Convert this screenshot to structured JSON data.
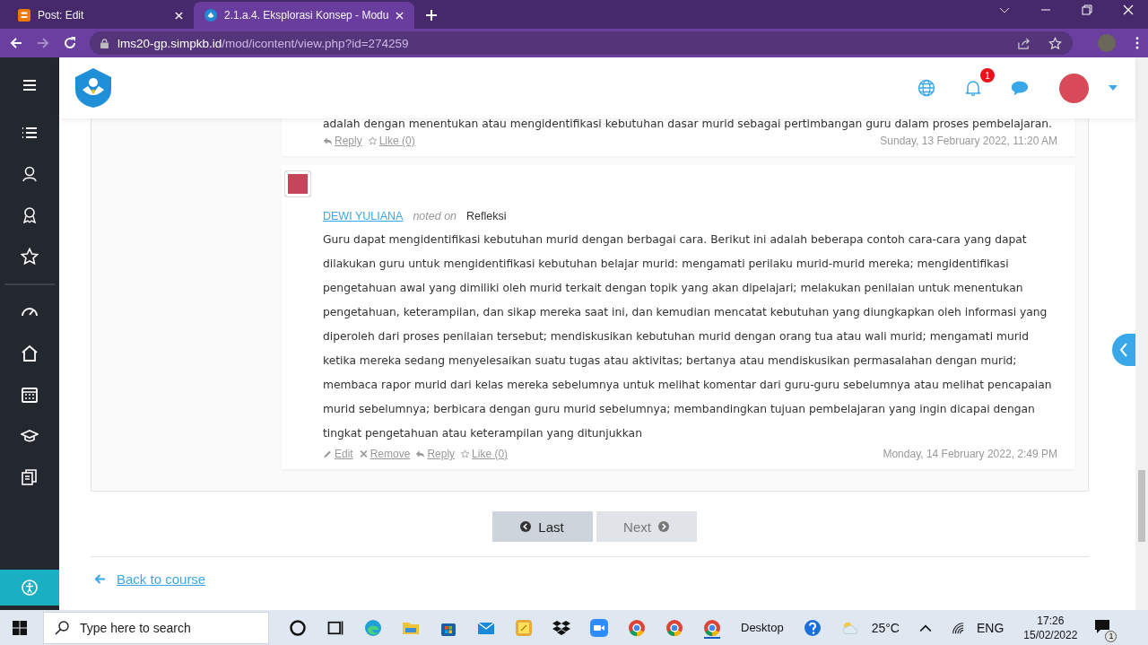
{
  "browser": {
    "tabs": [
      {
        "title": "Post: Edit",
        "kind": "blogger",
        "selected": false
      },
      {
        "title": "2.1.a.4. Eksplorasi Konsep - Modu",
        "kind": "site",
        "selected": true
      }
    ],
    "url": {
      "host": "lms20-gp.simpkb.id",
      "path": "/mod/icontent/view.php?id=274259"
    }
  },
  "header": {
    "notification_count": "1"
  },
  "comments": [
    {
      "text": "adalah dengan menentukan atau mengidentifikasi kebutuhan dasar murid sebagai pertimbangan guru dalam proses pembelajaran.",
      "actions": [
        {
          "kind": "reply",
          "label": "Reply"
        },
        {
          "kind": "like",
          "label": "Like (0)"
        }
      ],
      "timestamp": "Sunday, 13 February 2022, 11:20 AM"
    },
    {
      "author": "DEWI YULIANA",
      "noted_on": "noted on",
      "topic": "Refleksi",
      "text": "Guru dapat mengidentifikasi kebutuhan murid dengan berbagai cara. Berikut ini adalah beberapa contoh cara-cara yang dapat dilakukan guru untuk mengidentifikasi kebutuhan belajar murid: mengamati perilaku murid-murid mereka; mengidentifikasi pengetahuan awal yang dimiliki oleh murid terkait dengan topik yang akan dipelajari; melakukan penilaian untuk menentukan pengetahuan, keterampilan, dan sikap mereka saat ini, dan kemudian mencatat kebutuhan yang diungkapkan oleh informasi yang diperoleh dari proses penilaian tersebut; mendiskusikan kebutuhan murid dengan orang tua atau wali murid; mengamati murid ketika mereka sedang menyelesaikan suatu tugas atau aktivitas; bertanya atau mendiskusikan permasalahan dengan murid; membaca rapor murid dari kelas mereka sebelumnya untuk melihat komentar dari guru-guru sebelumnya atau melihat pencapaian murid sebelumnya; berbicara dengan guru murid sebelumnya; membandingkan tujuan pembelajaran yang ingin dicapai dengan tingkat pengetahuan atau keterampilan yang ditunjukkan",
      "actions": [
        {
          "kind": "edit",
          "label": "Edit"
        },
        {
          "kind": "remove",
          "label": "Remove"
        },
        {
          "kind": "reply",
          "label": "Reply"
        },
        {
          "kind": "like",
          "label": "Like (0)"
        }
      ],
      "timestamp": "Monday, 14 February 2022, 2:49 PM"
    }
  ],
  "pager": [
    {
      "kind": "prev",
      "label": "Last",
      "disabled": false
    },
    {
      "kind": "next",
      "label": "Next",
      "disabled": true
    }
  ],
  "back_link": "Back to course",
  "taskbar": {
    "search_placeholder": "Type here to search",
    "toolbar_label": "Desktop",
    "temperature": "25°C",
    "language": "ENG",
    "time": "17:26",
    "date": "15/02/2022",
    "notification_count": "1"
  }
}
